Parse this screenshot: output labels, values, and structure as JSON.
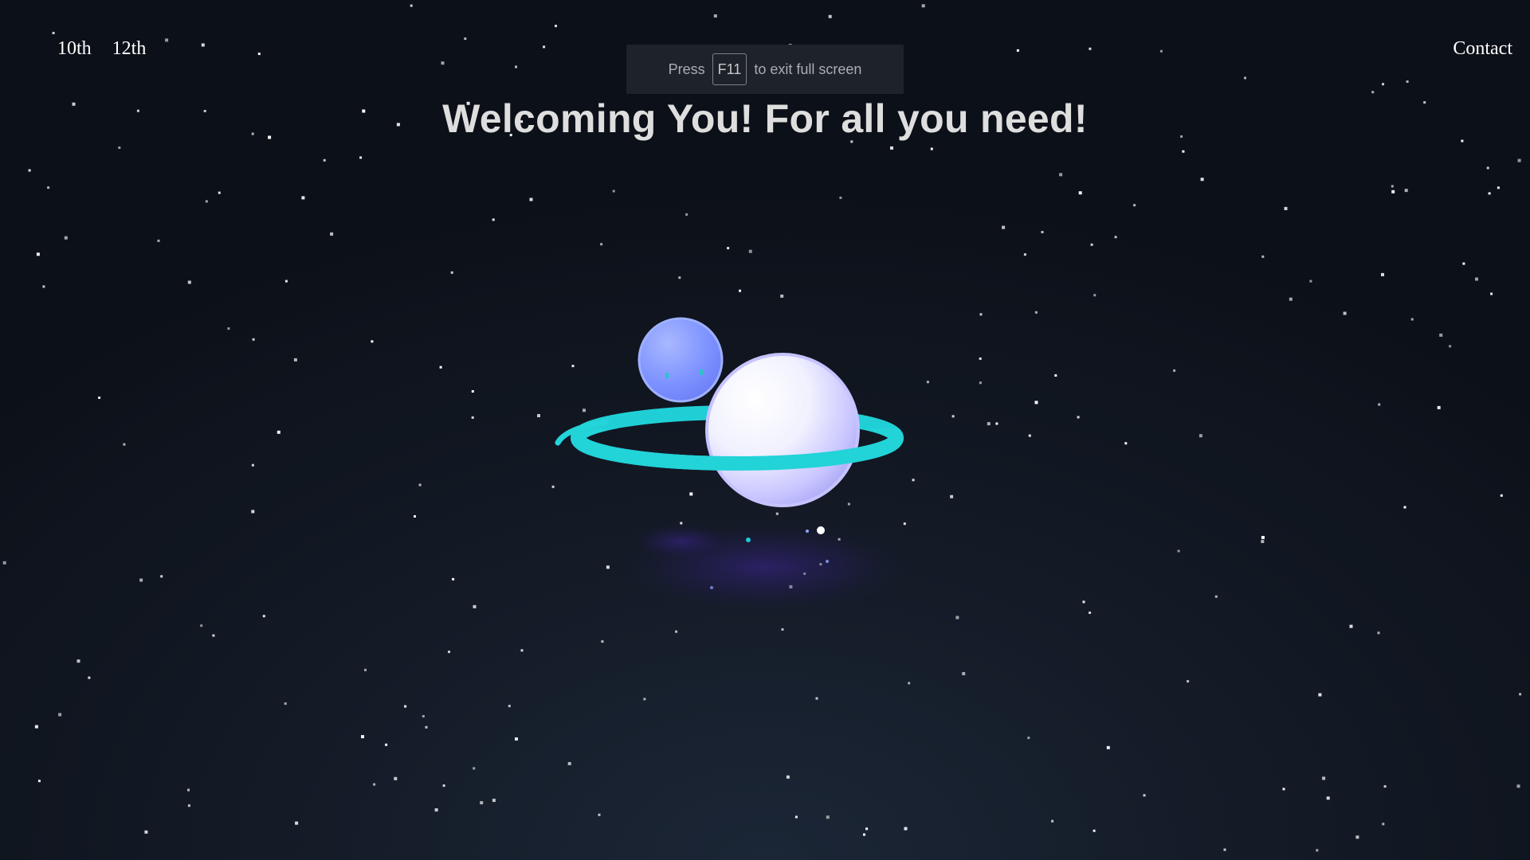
{
  "nav": {
    "items": [
      {
        "label": "10th"
      },
      {
        "label": "12th"
      }
    ],
    "contact_label": "Contact"
  },
  "fullscreen_notice": {
    "prefix": "Press",
    "key": "F11",
    "suffix": "to exit full screen"
  },
  "hero": {
    "title": "Welcoming You! For all you need!"
  },
  "colors": {
    "background": "#0f141c",
    "ring": "#22d3d8",
    "planet": "#e9ecff",
    "moon": "#7f97ff",
    "glow": "#2e1f5e",
    "star": "#ffffff"
  },
  "icons": {
    "illustration": "planet-with-ring-icon",
    "moon": "moon-icon"
  }
}
